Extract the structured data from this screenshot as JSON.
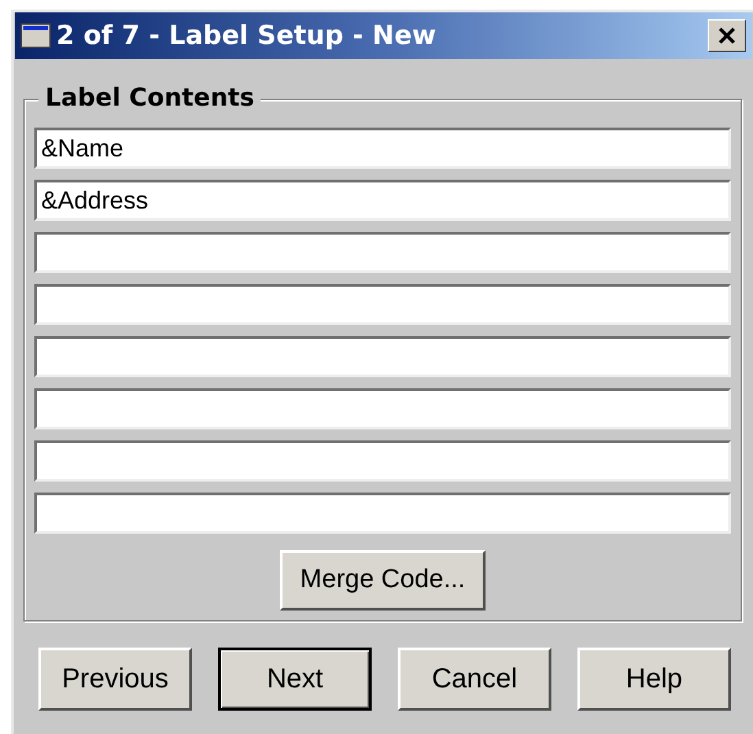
{
  "window": {
    "title": "2 of 7 - Label Setup - New"
  },
  "group": {
    "title": "Label Contents",
    "fields": [
      {
        "kind": "filled",
        "value": "&Name"
      },
      {
        "kind": "filled",
        "value": "&Address"
      },
      {
        "kind": "blank"
      },
      {
        "kind": "blank"
      },
      {
        "kind": "blank"
      },
      {
        "kind": "blank"
      },
      {
        "kind": "blank"
      },
      {
        "kind": "blank"
      }
    ],
    "merge_button": "Merge Code..."
  },
  "buttons": [
    {
      "label": "Previous",
      "default": false
    },
    {
      "label": "Next",
      "default": true
    },
    {
      "label": "Cancel",
      "default": false
    },
    {
      "label": "Help",
      "default": false
    }
  ]
}
